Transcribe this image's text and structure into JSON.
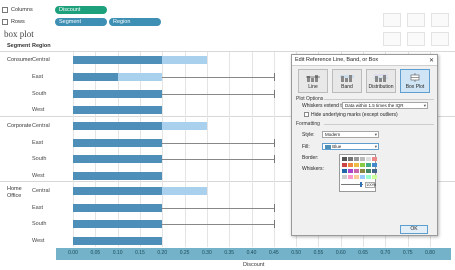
{
  "shelves": {
    "columns_label": "Columns",
    "columns_pills": [
      "Discount"
    ],
    "rows_label": "Rows",
    "rows_pills": [
      "Segment",
      "Region"
    ]
  },
  "title": "box plot",
  "table": {
    "segment_header": "Segment",
    "region_header": "Region",
    "segments": [
      {
        "label": "Consumer",
        "regions": [
          "Central",
          "East",
          "South",
          "West"
        ]
      },
      {
        "label": "Corporate",
        "regions": [
          "Central",
          "East",
          "South",
          "West"
        ]
      },
      {
        "label": "Home Office",
        "regions": [
          "Central",
          "East",
          "South",
          "West"
        ]
      }
    ]
  },
  "axis": {
    "title": "Discount",
    "ticks": [
      "0.00",
      "0.05",
      "0.10",
      "0.15",
      "0.20",
      "0.25",
      "0.30",
      "0.35",
      "0.40",
      "0.45",
      "0.50",
      "0.55",
      "0.60",
      "0.65",
      "0.70",
      "0.75",
      "0.80"
    ]
  },
  "boxes": [
    {
      "q1": 0.0,
      "median": 0.2,
      "q3": 0.3,
      "whisker_max": 0.3
    },
    {
      "q1": 0.0,
      "median": 0.1,
      "q3": 0.2,
      "whisker_max": 0.45
    },
    {
      "q1": 0.0,
      "median": 0.2,
      "q3": 0.2,
      "whisker_max": 0.45
    },
    {
      "q1": 0.0,
      "median": 0.2,
      "q3": 0.2,
      "whisker_max": 0.2
    },
    {
      "q1": 0.0,
      "median": 0.2,
      "q3": 0.3,
      "whisker_max": 0.3
    },
    {
      "q1": 0.0,
      "median": 0.2,
      "q3": 0.2,
      "whisker_max": 0.45
    },
    {
      "q1": 0.0,
      "median": 0.2,
      "q3": 0.2,
      "whisker_max": 0.45
    },
    {
      "q1": 0.0,
      "median": 0.2,
      "q3": 0.2,
      "whisker_max": 0.2
    },
    {
      "q1": 0.0,
      "median": 0.2,
      "q3": 0.3,
      "whisker_max": 0.3
    },
    {
      "q1": 0.0,
      "median": 0.2,
      "q3": 0.2,
      "whisker_max": 0.45
    },
    {
      "q1": 0.0,
      "median": 0.2,
      "q3": 0.2,
      "whisker_max": 0.45
    },
    {
      "q1": 0.0,
      "median": 0.2,
      "q3": 0.2,
      "whisker_max": 0.2
    }
  ],
  "colors": {
    "box_lower": "#4d8fb8",
    "box_upper": "#a9d0ec",
    "axis_band": "#73b2c8",
    "columns_pill": "#1da07c",
    "rows_pill": "#3d8fb3"
  },
  "dialog": {
    "title": "Edit Reference Line, Band, or Box",
    "close": "✕",
    "types": [
      "Line",
      "Band",
      "Distribution",
      "Box Plot"
    ],
    "active_type": "Box Plot",
    "plot_options_label": "Plot Options",
    "whiskers_label": "Whiskers extend to:",
    "whiskers_value": "Data within 1.5 times the IQR",
    "hide_marks_label": "Hide underlying marks (except outliers)",
    "formatting_label": "Formatting",
    "style_label": "Style:",
    "style_value": "Modern",
    "fill_label": "Fill:",
    "fill_value": "Blue",
    "border_label": "Border:",
    "whiskers_fmt_label": "Whiskers:",
    "opacity_value": "100%",
    "ok_label": "OK"
  }
}
